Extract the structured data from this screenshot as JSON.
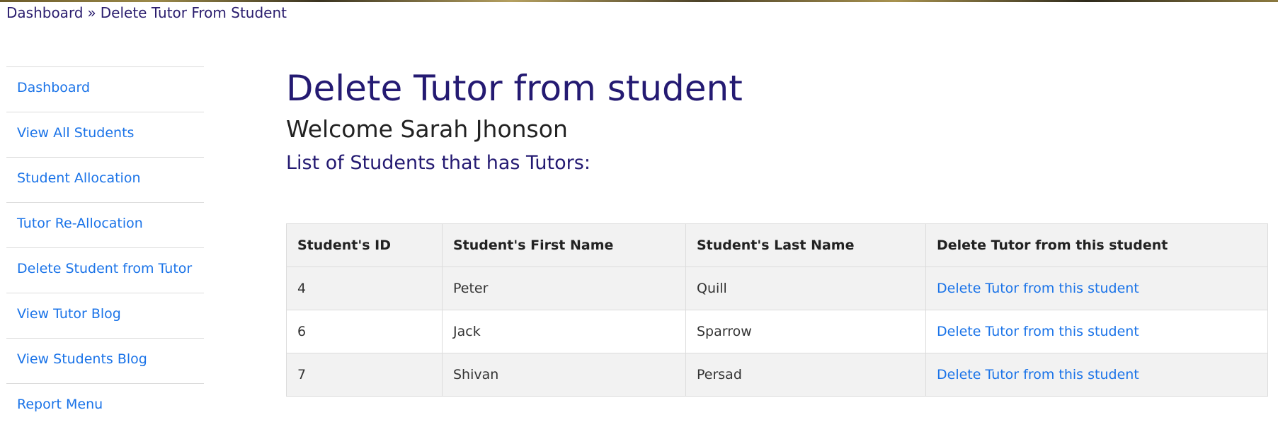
{
  "breadcrumb": {
    "home": "Dashboard",
    "separator": "»",
    "current": "Delete Tutor From Student"
  },
  "sidebar": {
    "items": [
      {
        "label": "Dashboard"
      },
      {
        "label": "View All Students"
      },
      {
        "label": "Student Allocation"
      },
      {
        "label": "Tutor Re-Allocation"
      },
      {
        "label": "Delete Student from Tutor"
      },
      {
        "label": "View Tutor Blog"
      },
      {
        "label": "View Students Blog"
      },
      {
        "label": "Report Menu"
      }
    ]
  },
  "main": {
    "title": "Delete Tutor from student",
    "welcome": "Welcome Sarah Jhonson",
    "list_heading": "List of Students that has Tutors:"
  },
  "table": {
    "headers": [
      "Student's ID",
      "Student's First Name",
      "Student's Last Name",
      "Delete Tutor from this student"
    ],
    "rows": [
      {
        "id": "4",
        "first": "Peter",
        "last": "Quill",
        "action": "Delete Tutor from this student"
      },
      {
        "id": "6",
        "first": "Jack",
        "last": "Sparrow",
        "action": "Delete Tutor from this student"
      },
      {
        "id": "7",
        "first": "Shivan",
        "last": "Persad",
        "action": "Delete Tutor from this student"
      }
    ]
  },
  "colors": {
    "heading": "#241a72",
    "link": "#1a73e8",
    "row_stripe": "#f2f2f2",
    "border": "#dcdcdc"
  }
}
